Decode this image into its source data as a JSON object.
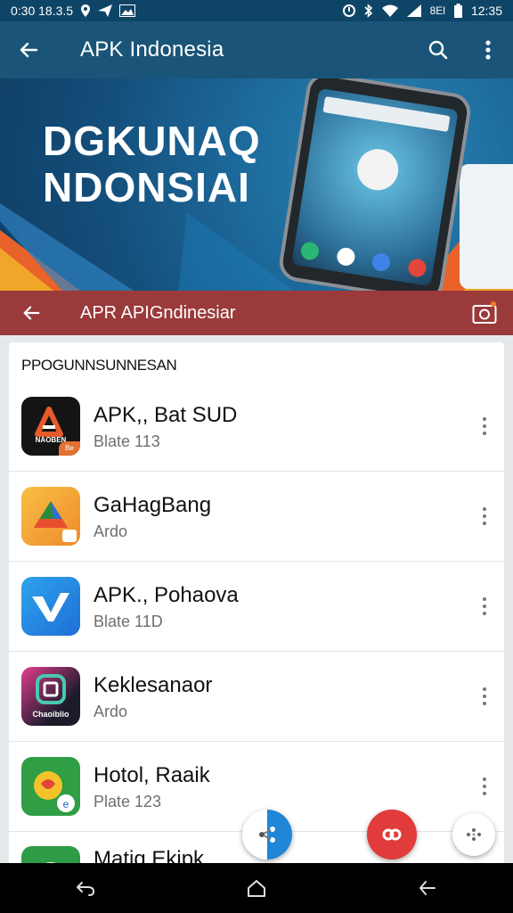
{
  "status_bar": {
    "left_text": "0:30 18.3.5",
    "battery_label": "8El",
    "time": "12:35"
  },
  "app_bar": {
    "title": "APK Indonesia"
  },
  "hero": {
    "line1": "DGKUNAQ",
    "line2": "NDONSIAI"
  },
  "sub_header": {
    "title": "APR APIGndinesiar"
  },
  "list": {
    "section_title": "PPOGUNNSUNNESAN",
    "items": [
      {
        "name": "APK,, Bat SUD",
        "subtitle": "Blate 113",
        "icon_label": "NAOBEN",
        "badge": "Be"
      },
      {
        "name": "GaHagBang",
        "subtitle": "Ardo"
      },
      {
        "name": "APK., Pohaova",
        "subtitle": "Blate 11D"
      },
      {
        "name": "Keklesanaor",
        "subtitle": "Ardo",
        "icon_label": "Chaoiblio"
      },
      {
        "name": "Hotol, Raaik",
        "subtitle": "Plate 123"
      },
      {
        "name": "Matig Ekipk",
        "subtitle": ""
      }
    ]
  },
  "colors": {
    "app_bar": "#1a5478",
    "status_bar": "#0e4566",
    "sub_header": "#9a3a3a",
    "card": "#ffffff"
  }
}
